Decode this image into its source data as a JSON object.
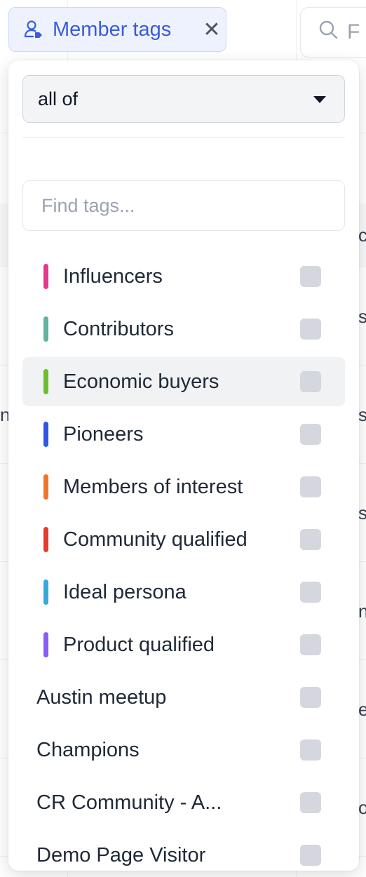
{
  "filter_chip": {
    "label": "Member tags",
    "icon": "user-tag-icon",
    "close_icon": "close-icon",
    "accent": "#3b5bdb"
  },
  "search": {
    "icon": "search-icon",
    "partial_text": "F"
  },
  "background_fragments": [
    "c",
    "s",
    "n",
    "s",
    "s",
    "n",
    "e",
    "o"
  ],
  "dropdown": {
    "mode": {
      "selected": "all of",
      "icon": "caret-down-icon"
    },
    "tag_search": {
      "placeholder": "Find tags..."
    },
    "tags": [
      {
        "name": "Influencers",
        "color": "#e8368f",
        "checked": false
      },
      {
        "name": "Contributors",
        "color": "#5fb3a1",
        "checked": false
      },
      {
        "name": "Economic buyers",
        "color": "#6abf2e",
        "checked": false,
        "hovered": true
      },
      {
        "name": "Pioneers",
        "color": "#2f55e4",
        "checked": false
      },
      {
        "name": "Members of interest",
        "color": "#f0742e",
        "checked": false
      },
      {
        "name": "Community qualified",
        "color": "#e53b2c",
        "checked": false
      },
      {
        "name": "Ideal persona",
        "color": "#36a9dc",
        "checked": false
      },
      {
        "name": "Product qualified",
        "color": "#8b5cf6",
        "checked": false
      },
      {
        "name": "Austin meetup",
        "color": null,
        "checked": false
      },
      {
        "name": "Champions",
        "color": null,
        "checked": false
      },
      {
        "name": "CR Community - A...",
        "color": null,
        "checked": false
      },
      {
        "name": "Demo Page Visitor",
        "color": null,
        "checked": false
      }
    ]
  }
}
